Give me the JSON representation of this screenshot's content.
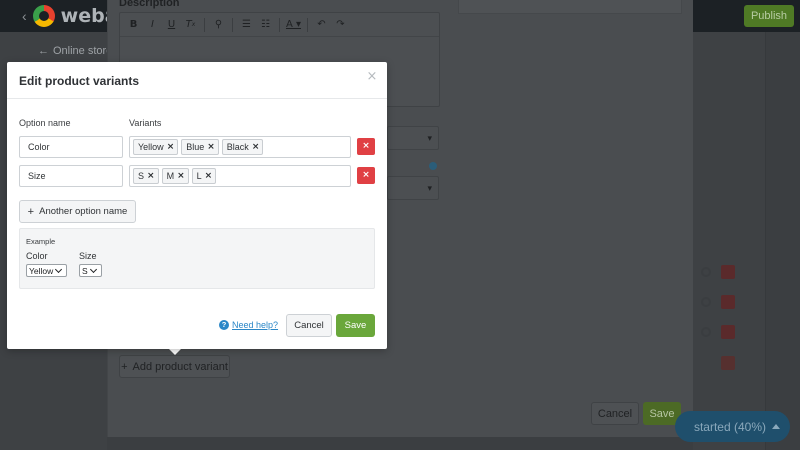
{
  "app": {
    "brand_name": "webac",
    "publish_label": "Publish",
    "back_label": "Online store",
    "description_label": "Description",
    "editor_tools": [
      "bold-icon",
      "italic-icon",
      "underline-icon",
      "clear-format-icon",
      "link-icon",
      "bullet-list-icon",
      "numbered-list-icon",
      "text-color-icon",
      "undo-icon",
      "redo-icon"
    ],
    "add_variant_label": "Add product variant",
    "cancel_label": "Cancel",
    "save_label": "Save",
    "get_started_label": "started (40%)"
  },
  "modal": {
    "title": "Edit product variants",
    "close_label": "×",
    "option_name_header": "Option name",
    "variants_header": "Variants",
    "options": [
      {
        "name": "Color",
        "variants": [
          "Yellow",
          "Blue",
          "Black"
        ]
      },
      {
        "name": "Size",
        "variants": [
          "S",
          "M",
          "L"
        ]
      }
    ],
    "remove_label": "×",
    "tag_remove_label": "×",
    "another_option_label": "Another option name",
    "example": {
      "title": "Example",
      "fields": [
        {
          "label": "Color",
          "selected": "Yellow"
        },
        {
          "label": "Size",
          "selected": "S"
        }
      ]
    },
    "help_label": "Need help?",
    "cancel_label": "Cancel",
    "save_label": "Save"
  },
  "colors": {
    "save_green": "#6aa73b",
    "remove_red": "#e04044",
    "link_blue": "#2b87c7"
  }
}
